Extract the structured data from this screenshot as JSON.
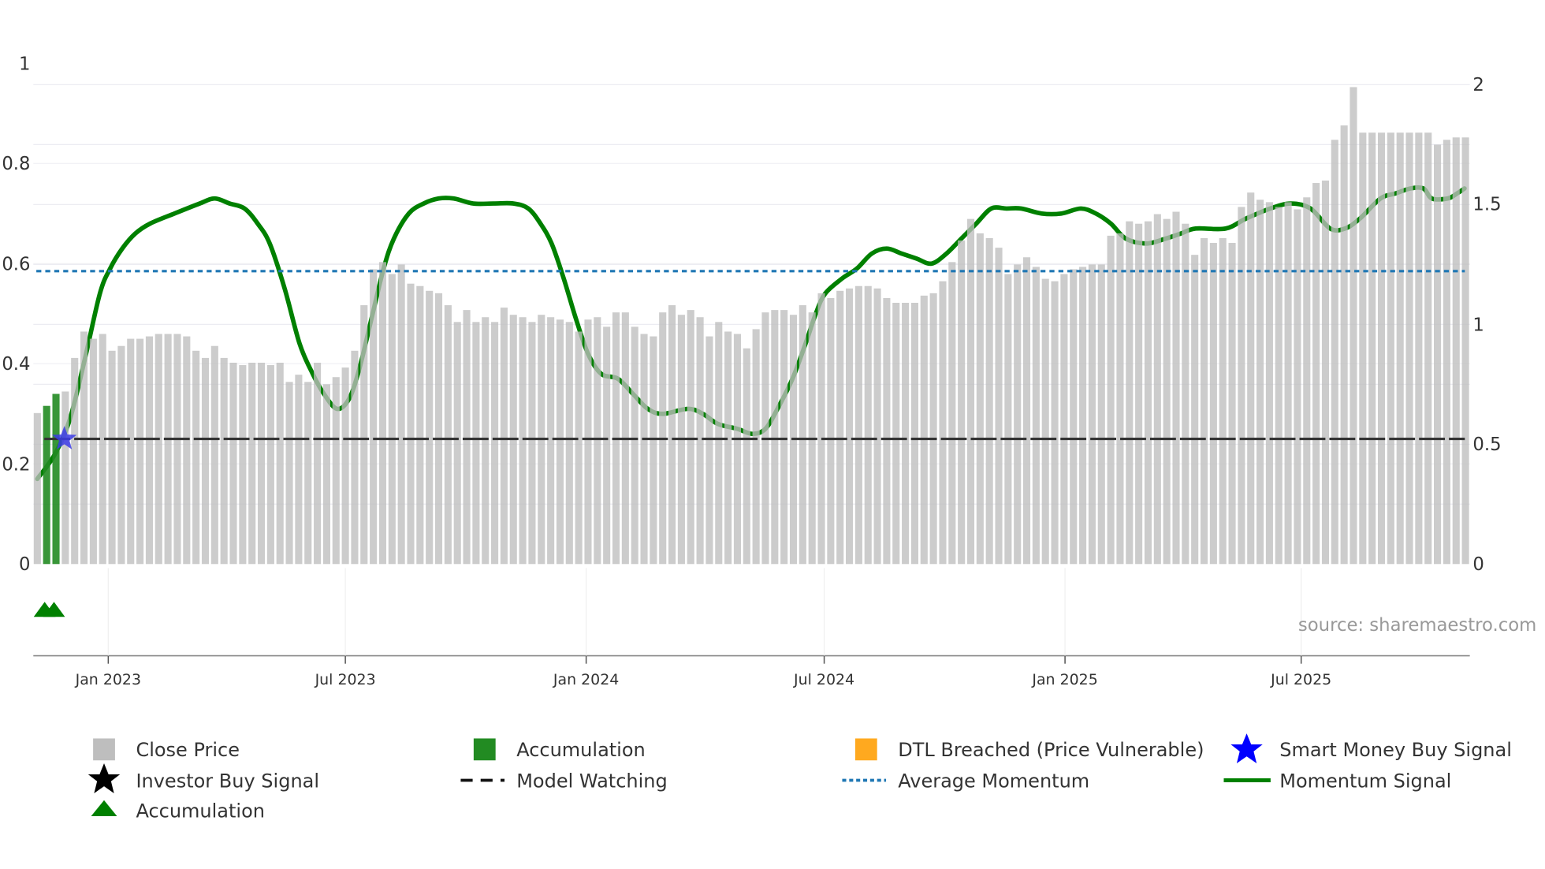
{
  "chart_data": {
    "type": "bar",
    "title": "",
    "x_unit": "week index",
    "left_axis": {
      "ylim": [
        0,
        1
      ],
      "ticks": [
        "0",
        "0.2",
        "0.4",
        "0.6",
        "0.8",
        "1"
      ]
    },
    "right_axis": {
      "ylim": [
        0,
        2
      ],
      "ticks": [
        "0",
        "0.5",
        "1",
        "1.5",
        "2"
      ]
    },
    "x_ticks": [
      {
        "label": "Jan 2023",
        "week": 7.6
      },
      {
        "label": "Jul 2023",
        "week": 33.0
      },
      {
        "label": "Jan 2024",
        "week": 58.8
      },
      {
        "label": "Jul 2024",
        "week": 84.3
      },
      {
        "label": "Jan 2025",
        "week": 110.1
      },
      {
        "label": "Jul 2025",
        "week": 135.4
      }
    ],
    "close_price": [
      0.63,
      0.66,
      0.71,
      0.72,
      0.86,
      0.97,
      0.94,
      0.96,
      0.89,
      0.91,
      0.94,
      0.94,
      0.95,
      0.96,
      0.96,
      0.96,
      0.95,
      0.89,
      0.86,
      0.91,
      0.86,
      0.84,
      0.83,
      0.84,
      0.84,
      0.83,
      0.84,
      0.76,
      0.79,
      0.76,
      0.84,
      0.75,
      0.78,
      0.82,
      0.89,
      1.08,
      1.23,
      1.26,
      1.21,
      1.25,
      1.17,
      1.16,
      1.14,
      1.13,
      1.08,
      1.01,
      1.06,
      1.01,
      1.03,
      1.01,
      1.07,
      1.04,
      1.03,
      1.01,
      1.04,
      1.03,
      1.02,
      1.01,
      0.97,
      1.02,
      1.03,
      0.99,
      1.05,
      1.05,
      0.99,
      0.96,
      0.95,
      1.05,
      1.08,
      1.04,
      1.06,
      1.03,
      0.95,
      1.01,
      0.97,
      0.96,
      0.9,
      0.98,
      1.05,
      1.06,
      1.06,
      1.04,
      1.08,
      1.05,
      1.13,
      1.11,
      1.14,
      1.15,
      1.16,
      1.16,
      1.15,
      1.11,
      1.09,
      1.09,
      1.09,
      1.12,
      1.13,
      1.18,
      1.26,
      1.35,
      1.44,
      1.38,
      1.36,
      1.32,
      1.21,
      1.25,
      1.28,
      1.24,
      1.19,
      1.18,
      1.21,
      1.23,
      1.24,
      1.25,
      1.25,
      1.37,
      1.38,
      1.43,
      1.42,
      1.43,
      1.46,
      1.44,
      1.47,
      1.42,
      1.29,
      1.36,
      1.34,
      1.36,
      1.34,
      1.49,
      1.55,
      1.52,
      1.51,
      1.49,
      1.51,
      1.48,
      1.53,
      1.59,
      1.6,
      1.77,
      1.83,
      1.99,
      1.8,
      1.8,
      1.8,
      1.8,
      1.8,
      1.8,
      1.8,
      1.8,
      1.75,
      1.77,
      1.78,
      1.78
    ],
    "accumulation_bars": [
      1,
      2
    ],
    "accumulation_markers": [
      1,
      2
    ],
    "smart_money_buy": [
      {
        "week": 3,
        "value": 0.25
      }
    ],
    "model_watching_level": 0.25,
    "average_momentum": 0.585,
    "momentum": {
      "week": [
        0,
        1.9,
        3.5,
        5.1,
        6.7,
        7.8,
        9.1,
        10.5,
        12.1,
        14.7,
        17.4,
        19.0,
        20.6,
        22.2,
        23.6,
        24.9,
        26.5,
        28.1,
        29.5,
        30.7,
        32.1,
        33.4,
        34.5,
        35.8,
        37.1,
        38.2,
        39.8,
        41.4,
        43.0,
        44.6,
        46.7,
        48.9,
        51.0,
        52.6,
        53.9,
        55.1,
        56.4,
        57.7,
        59.0,
        60.4,
        62.2,
        63.8,
        65.4,
        67.0,
        69.7,
        71.3,
        72.9,
        75.0,
        76.6,
        78.0,
        79.3,
        80.9,
        82.3,
        83.4,
        84.4,
        86.2,
        87.8,
        89.4,
        91.0,
        92.6,
        94.2,
        95.8,
        97.4,
        99.0,
        100.6,
        102.2,
        103.8,
        105.4,
        107.6,
        109.7,
        111.8,
        113.4,
        115.0,
        116.6,
        118.8,
        120.9,
        122.5,
        124.1,
        127.3,
        129.5,
        132.1,
        134.3,
        136.4,
        138.5,
        140.1,
        141.7,
        143.9,
        145.5,
        147.1,
        148.5,
        149.4,
        151.1,
        152.1,
        152.9
      ],
      "values": [
        0.17,
        0.22,
        0.29,
        0.41,
        0.54,
        0.59,
        0.63,
        0.66,
        0.68,
        0.7,
        0.72,
        0.73,
        0.72,
        0.71,
        0.68,
        0.64,
        0.55,
        0.44,
        0.38,
        0.34,
        0.31,
        0.33,
        0.39,
        0.49,
        0.59,
        0.65,
        0.7,
        0.72,
        0.73,
        0.73,
        0.72,
        0.72,
        0.72,
        0.71,
        0.68,
        0.64,
        0.57,
        0.49,
        0.42,
        0.38,
        0.37,
        0.34,
        0.31,
        0.3,
        0.31,
        0.3,
        0.28,
        0.27,
        0.26,
        0.27,
        0.31,
        0.37,
        0.44,
        0.5,
        0.54,
        0.57,
        0.59,
        0.62,
        0.63,
        0.62,
        0.61,
        0.6,
        0.62,
        0.65,
        0.68,
        0.71,
        0.71,
        0.71,
        0.7,
        0.7,
        0.71,
        0.7,
        0.68,
        0.65,
        0.64,
        0.65,
        0.66,
        0.67,
        0.67,
        0.69,
        0.71,
        0.72,
        0.71,
        0.67,
        0.67,
        0.69,
        0.73,
        0.74,
        0.75,
        0.75,
        0.73,
        0.73,
        0.74,
        0.75
      ]
    },
    "legend": [
      {
        "label": "Close Price",
        "icon": "gray-square"
      },
      {
        "label": "Accumulation",
        "icon": "green-square"
      },
      {
        "label": "DTL Breached (Price Vulnerable)",
        "icon": "orange-square"
      },
      {
        "label": "Smart Money Buy Signal",
        "icon": "blue-star"
      },
      {
        "label": "Investor Buy Signal",
        "icon": "black-star"
      },
      {
        "label": "Model Watching",
        "icon": "black-dash"
      },
      {
        "label": "Average Momentum",
        "icon": "blue-dots"
      },
      {
        "label": "Momentum Signal",
        "icon": "green-line"
      },
      {
        "label": "Accumulation",
        "icon": "green-triangle"
      }
    ],
    "legend_placement": "bottom",
    "source": "source: sharemaestro.com",
    "colors": {
      "price": "#bebebe",
      "accumulation": "#228b22",
      "dtl": "#ffa500",
      "smart_money": "#0000ff",
      "investor": "#000000",
      "watching": "#333333",
      "avg_momentum": "#1f77b4",
      "momentum": "#008000"
    }
  }
}
